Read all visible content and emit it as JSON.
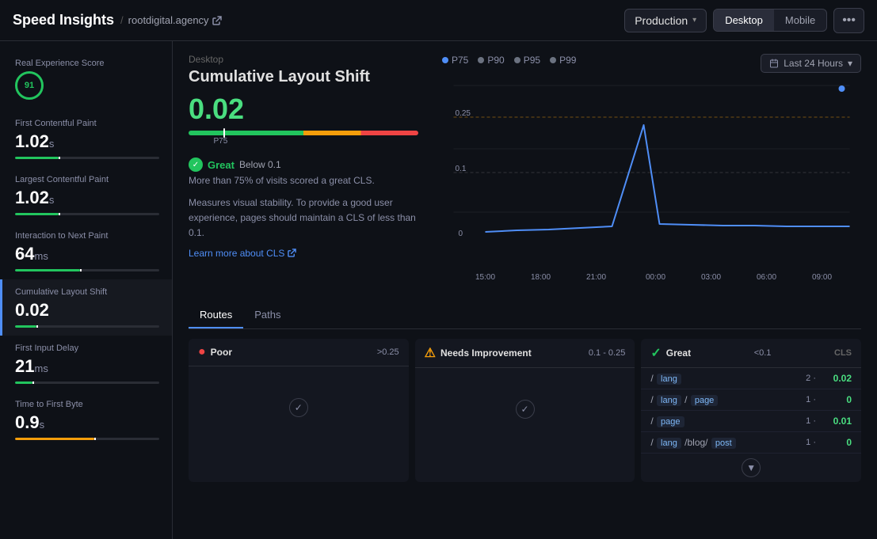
{
  "app": {
    "logo": "Speed Insights",
    "breadcrumb_slash": "/",
    "site_link": "rootdigital.agency",
    "external_icon": "↗"
  },
  "header": {
    "env_label": "Production",
    "env_chevron": "▾",
    "device_options": [
      "Desktop",
      "Mobile"
    ],
    "active_device": "Desktop",
    "more_icon": "•••",
    "time_label": "Last 24 Hours",
    "time_chevron": "▾"
  },
  "legend": {
    "items": [
      {
        "label": "P75",
        "color": "#4f8ef7"
      },
      {
        "label": "P90",
        "color": "#8b8fa8"
      },
      {
        "label": "P95",
        "color": "#8b8fa8"
      },
      {
        "label": "P99",
        "color": "#8b8fa8"
      }
    ]
  },
  "sidebar": {
    "metrics": [
      {
        "id": "res",
        "label": "Real Experience Score",
        "value": "91",
        "unit": "",
        "is_score": true,
        "bar_pct": 91,
        "bar_color": "bar-green",
        "marker_pct": 91
      },
      {
        "id": "fcp",
        "label": "First Contentful Paint",
        "value": "1.02",
        "unit": "s",
        "is_score": false,
        "bar_pct": 30,
        "bar_color": "bar-green",
        "marker_pct": 30
      },
      {
        "id": "lcp",
        "label": "Largest Contentful Paint",
        "value": "1.02",
        "unit": "s",
        "is_score": false,
        "bar_pct": 30,
        "bar_color": "bar-green",
        "marker_pct": 30
      },
      {
        "id": "inp",
        "label": "Interaction to Next Paint",
        "value": "64",
        "unit": "ms",
        "is_score": false,
        "bar_pct": 45,
        "bar_color": "bar-green",
        "marker_pct": 45
      },
      {
        "id": "cls",
        "label": "Cumulative Layout Shift",
        "value": "0.02",
        "unit": "",
        "is_score": false,
        "bar_pct": 15,
        "bar_color": "bar-green",
        "marker_pct": 15,
        "active": true
      },
      {
        "id": "fid",
        "label": "First Input Delay",
        "value": "21",
        "unit": "ms",
        "is_score": false,
        "bar_pct": 12,
        "bar_color": "bar-green",
        "marker_pct": 12
      },
      {
        "id": "ttfb",
        "label": "Time to First Byte",
        "value": "0.9",
        "unit": "s",
        "is_score": false,
        "bar_pct": 55,
        "bar_color": "bar-yellow",
        "marker_pct": 55
      }
    ]
  },
  "content": {
    "breadcrumb": "Desktop",
    "title": "Cumulative Layout Shift",
    "value": "0.02",
    "progress_marker_pct": 15,
    "p75_label": "P75",
    "rating_label": "Great",
    "below_text": "Below 0.1",
    "more_75_text": "More than 75% of visits scored a great CLS.",
    "description": "Measures visual stability. To provide a good user experience, pages should maintain a CLS of less than 0.1.",
    "learn_link": "Learn more about CLS",
    "chart_ref_lines": [
      {
        "label": "0.25",
        "pct": 75
      },
      {
        "label": "0.1",
        "pct": 45
      },
      {
        "label": "0",
        "pct": 0
      }
    ],
    "x_axis": [
      "15:00",
      "18:00",
      "21:00",
      "00:00",
      "03:00",
      "06:00",
      "09:00"
    ]
  },
  "tabs": {
    "items": [
      "Routes",
      "Paths"
    ],
    "active": "Routes"
  },
  "routes": {
    "cols": [
      {
        "id": "poor",
        "icon": "●",
        "icon_class": "poor-dot",
        "label": "Poor",
        "range": ">0.25",
        "rows": []
      },
      {
        "id": "needs",
        "icon": "⚠",
        "icon_class": "warn-dot",
        "label": "Needs Improvement",
        "range": "0.1 - 0.25",
        "rows": []
      },
      {
        "id": "great",
        "icon": "✓",
        "icon_class": "good-dot",
        "label": "Great",
        "range": "<0.1",
        "cls_label": "CLS",
        "rows": [
          {
            "path": "/ lang",
            "path_parts": [
              "/",
              "lang"
            ],
            "count": "2",
            "value": "0.02",
            "val_class": "val-green"
          },
          {
            "path": "/ lang / page",
            "path_parts": [
              "/",
              "lang",
              "/",
              "page"
            ],
            "count": "1",
            "value": "0",
            "val_class": "val-green"
          },
          {
            "path": "/ page",
            "path_parts": [
              "/",
              "page"
            ],
            "count": "1",
            "value": "0.01",
            "val_class": "val-green"
          },
          {
            "path": "/ lang /blog/ post",
            "path_parts": [
              "/",
              "lang",
              "/blog/",
              "post"
            ],
            "count": "1",
            "value": "0",
            "val_class": "val-green"
          }
        ]
      }
    ]
  }
}
